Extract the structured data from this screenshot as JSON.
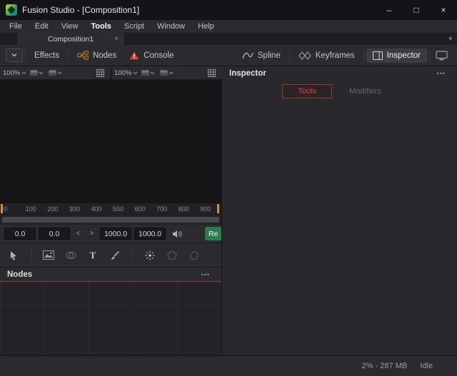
{
  "colors": {
    "accent_red": "#c9392c",
    "range_orange": "#d6922f",
    "render_green": "#2e7b4e"
  },
  "window": {
    "title": "Fusion Studio - [Composition1]",
    "minimize": "–",
    "maximize": "□",
    "close": "×"
  },
  "menu": {
    "items": [
      {
        "label": "File"
      },
      {
        "label": "Edit"
      },
      {
        "label": "View"
      },
      {
        "label": "Tools"
      },
      {
        "label": "Script"
      },
      {
        "label": "Window"
      },
      {
        "label": "Help"
      }
    ]
  },
  "tabbar": {
    "active_tab": "Composition1",
    "close": "×",
    "overflow": "▾"
  },
  "toolbar": {
    "effects": "Effects",
    "nodes": "Nodes",
    "console": "Console",
    "spline": "Spline",
    "keyframes": "Keyframes",
    "inspector": "Inspector"
  },
  "viewers": {
    "left": {
      "zoom": "100%"
    },
    "right": {
      "zoom": "100%"
    }
  },
  "timeline": {
    "ticks": [
      "0",
      "100",
      "200",
      "300",
      "400",
      "500",
      "600",
      "700",
      "800",
      "900"
    ],
    "range_in": "0.0",
    "current": "0.0",
    "step_back": "<",
    "step_fwd": ">",
    "range_out": "1000.0",
    "duration": "1000.0",
    "render": "Re"
  },
  "toolrow": {
    "text_tool": "T"
  },
  "nodes_panel": {
    "title": "Nodes",
    "menu": "•••"
  },
  "inspector": {
    "title": "Inspector",
    "menu": "•••",
    "tabs": [
      {
        "label": "Tools"
      },
      {
        "label": "Modifiers"
      }
    ]
  },
  "status": {
    "memory": "2% - 287 MB",
    "state": "Idle"
  }
}
